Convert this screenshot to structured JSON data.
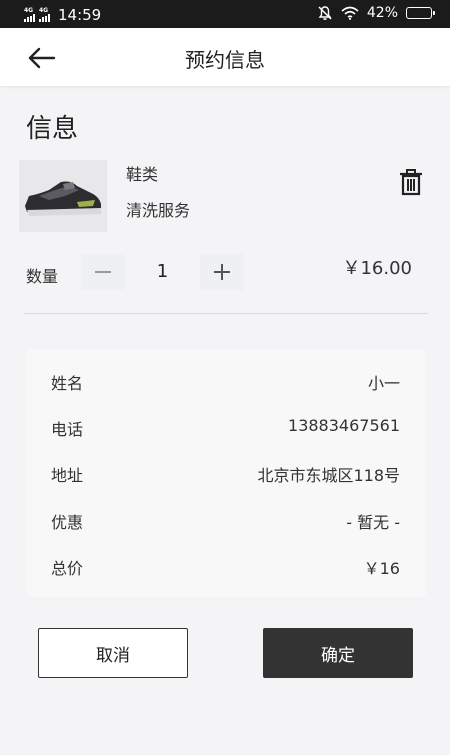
{
  "status_bar": {
    "network_1": "4G",
    "network_2": "4G",
    "time": "14:59",
    "battery": "42%",
    "battery_level": 0.42
  },
  "header": {
    "title": "预约信息",
    "back_icon": "arrow-left-icon"
  },
  "section": {
    "title": "信息"
  },
  "product": {
    "image": "sneaker-image",
    "category": "鞋类",
    "service": "清洗服务",
    "delete_icon": "trash-icon",
    "quantity_label": "数量",
    "quantity": "1",
    "price": "￥16.00"
  },
  "info": {
    "rows": [
      {
        "label": "姓名",
        "value": "小一"
      },
      {
        "label": "电话",
        "value": "13883467561"
      },
      {
        "label": "地址",
        "value": "北京市东城区118号"
      },
      {
        "label": "优惠",
        "value": "- 暂无 -"
      },
      {
        "label": "总价",
        "value": "￥16"
      }
    ]
  },
  "actions": {
    "cancel_label": "取消",
    "confirm_label": "确定"
  },
  "colors": {
    "background": "#f4f4f6",
    "dark_button": "#333333",
    "stepper_bg": "#eef0f3",
    "status_bar": "#1b1b1b"
  }
}
